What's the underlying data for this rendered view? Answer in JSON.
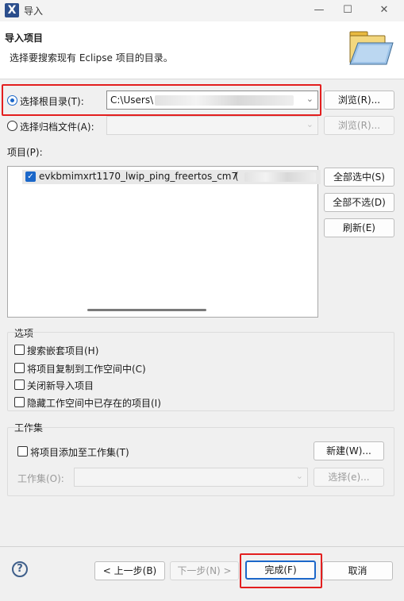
{
  "window": {
    "title": "导入",
    "app_icon_letter": "X"
  },
  "header": {
    "title": "导入项目",
    "description": "选择要搜索现有 Eclipse 项目的目录。"
  },
  "root_dir": {
    "label": "选择根目录(T):",
    "value": "C:\\Users\\",
    "selected": true,
    "browse_label": "浏览(R)..."
  },
  "archive": {
    "label": "选择归档文件(A):",
    "value": "",
    "selected": false,
    "browse_label": "浏览(R)..."
  },
  "projects": {
    "label": "项目(P):",
    "items": [
      {
        "name": "evkbmimxrt1170_lwip_ping_freertos_cm7",
        "suffix": "(",
        "checked": true
      }
    ],
    "select_all_label": "全部选中(S)",
    "deselect_all_label": "全部不选(D)",
    "refresh_label": "刷新(E)"
  },
  "options": {
    "title": "选项",
    "items": [
      {
        "label": "搜索嵌套项目(H)",
        "checked": false
      },
      {
        "label": "将项目复制到工作空间中(C)",
        "checked": false
      },
      {
        "label": "关闭新导入项目",
        "checked": false
      },
      {
        "label": "隐藏工作空间中已存在的项目(I)",
        "checked": false
      }
    ]
  },
  "working_set": {
    "title": "工作集",
    "add_label": "将项目添加至工作集(T)",
    "add_checked": false,
    "new_label": "新建(W)...",
    "field_label": "工作集(O):",
    "select_label": "选择(e)..."
  },
  "footer": {
    "help_symbol": "?",
    "back_label": "< 上一步(B)",
    "next_label": "下一步(N) >",
    "finish_label": "完成(F)",
    "cancel_label": "取消"
  },
  "colors": {
    "accent": "#1b67c9",
    "highlight_box": "#e31e1e",
    "folder": "#f0c95a"
  }
}
